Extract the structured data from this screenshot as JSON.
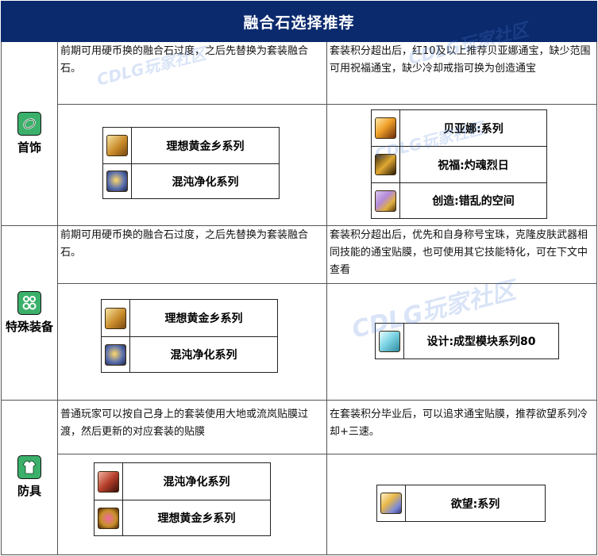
{
  "title": "融合石选择推荐",
  "watermark_text": "CDLG玩家社区",
  "rows": [
    {
      "category": "首饰",
      "category_icon": "ring-icon",
      "left_desc": "前期可用硬币换的融合石过度，之后先替换为套装融合石。",
      "right_desc": "套装积分超出后，红10及以上推荐贝亚娜通宝，缺少范围可用祝福通宝，缺少冷却戒指可换为创造通宝",
      "left_items": [
        {
          "icon": "golden-armor-icon",
          "name": "理想黄金乡系列"
        },
        {
          "icon": "chaos-orb-icon",
          "name": "混沌净化系列"
        }
      ],
      "right_items": [
        {
          "icon": "flame-sword-icon",
          "name": "贝亚娜:系列"
        },
        {
          "icon": "blessing-blade-icon",
          "name": "祝福:灼魂烈日"
        },
        {
          "icon": "creation-crystal-icon",
          "name": "创造:错乱的空间"
        }
      ]
    },
    {
      "category": "特殊装备",
      "category_icon": "earring-icon",
      "left_desc": "前期可用硬币换的融合石过度，之后先替换为套装融合石。",
      "right_desc": "套装积分超出后，优先和自身称号宝珠，克隆皮肤武器相同技能的通宝贴膜，也可使用其它技能特化，可在下文中查看",
      "left_items": [
        {
          "icon": "golden-armor-icon",
          "name": "理想黄金乡系列"
        },
        {
          "icon": "chaos-orb-icon",
          "name": "混沌净化系列"
        }
      ],
      "right_items": [
        {
          "icon": "module-box-icon",
          "name": "设计:成型模块系列80"
        }
      ]
    },
    {
      "category": "防具",
      "category_icon": "armor-icon",
      "left_desc": "普通玩家可以按自己身上的套装使用大地或流岚贴膜过渡，然后更新的对应套装的贴膜",
      "right_desc": "在套装积分毕业后，可以追求通宝贴膜，推荐欲望系列冷却+三速。",
      "left_items": [
        {
          "icon": "chaos-armor-icon",
          "name": "混沌净化系列"
        },
        {
          "icon": "golden-gem-icon",
          "name": "理想黄金乡系列"
        }
      ],
      "right_items": [
        {
          "icon": "desire-angel-icon",
          "name": "欲望:系列"
        }
      ]
    }
  ],
  "colors": {
    "title_bg": "#0b2a6e",
    "category_icon_bg": "#3bb06a",
    "grid_line": "#555555"
  }
}
